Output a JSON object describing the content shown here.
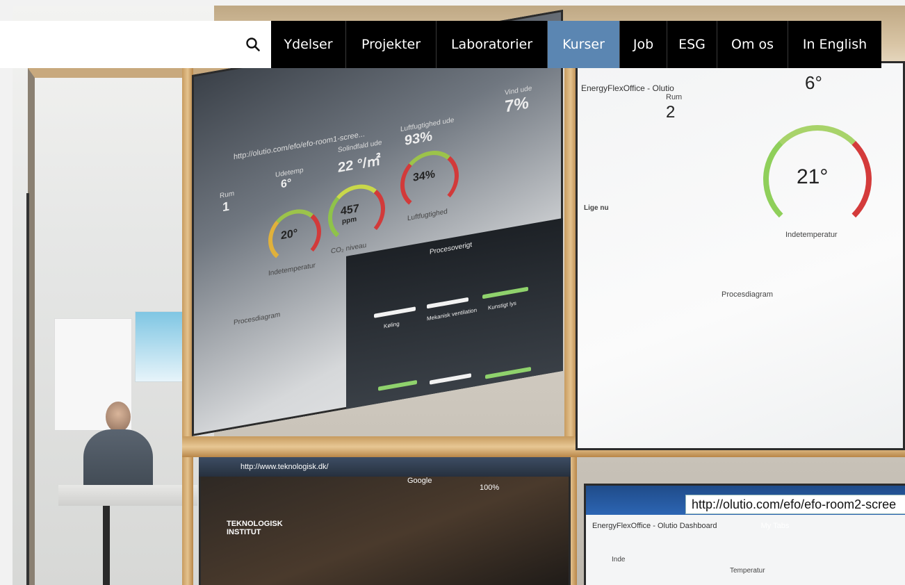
{
  "header": {
    "search": {
      "placeholder": "",
      "icon": "search-icon"
    },
    "nav": [
      {
        "label": "Ydelser",
        "active": false
      },
      {
        "label": "Projekter",
        "active": false
      },
      {
        "label": "Laboratorier",
        "active": false
      },
      {
        "label": "Kurser",
        "active": true
      },
      {
        "label": "Job",
        "active": false
      },
      {
        "label": "ESG",
        "active": false
      },
      {
        "label": "Om os",
        "active": false
      },
      {
        "label": "In English",
        "active": false
      }
    ],
    "colors": {
      "nav_bg": "#000000",
      "active_bg": "#5b86b2",
      "text": "#ffffff"
    }
  },
  "hero": {
    "main_screen": {
      "address": "http://olutio.com/efo/efo-room1-scree...",
      "gauges": [
        {
          "value": "20°",
          "caption": "Indetemperatur"
        },
        {
          "value": "457",
          "unit": "ppm",
          "caption": "CO₂ niveau"
        },
        {
          "value": "34%",
          "caption": "Luftfugtighed"
        }
      ],
      "readouts": [
        {
          "label": "Rum",
          "value": "1"
        },
        {
          "label": "Udetemp",
          "value": "6°"
        },
        {
          "label": "Solindfald ude",
          "value": "22 °/㎡"
        },
        {
          "label": "Luftfugtighed ude",
          "value": "93%"
        },
        {
          "label": "Vind ude",
          "value": "7%"
        }
      ],
      "process": {
        "title": "Procesoverigt",
        "items": [
          "Køling",
          "Mekanisk ventilation",
          "Kunstigt lys"
        ]
      },
      "procesdiagram": "Procesdiagram"
    },
    "right_screen": {
      "tab": "EnergyFlexOffice - Olutio",
      "room_label": "Rum",
      "room_value": "2",
      "outside_temp": "6°",
      "gauge_value": "21°",
      "gauge_caption": "Indetemperatur",
      "side_label": "Lige nu",
      "diagram_label": "Procesdiagram"
    },
    "bottom_left_screen": {
      "address": "http://www.teknologisk.dk/",
      "search_placeholder": "Google",
      "zoom": "100%",
      "logo_text": "TEKNOLOGISK INSTITUT"
    },
    "bottom_right_screen": {
      "address": "http://olutio.com/efo/efo-room2-scree",
      "tab": "EnergyFlexOffice - Olutio Dashboard",
      "tab2": "My Tabs",
      "section": "Temperatur",
      "row_label": "Inde"
    }
  }
}
